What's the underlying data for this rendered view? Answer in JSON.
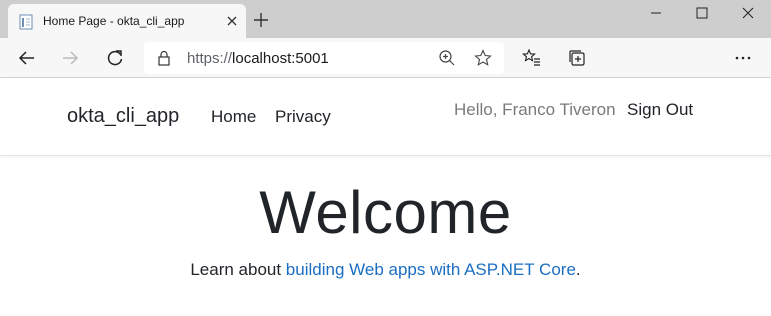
{
  "browser": {
    "tab_title": "Home Page - okta_cli_app",
    "url_prefix": "https://",
    "url_host": "localhost:5001",
    "icons": [
      "page-icon",
      "close-icon",
      "plus-icon",
      "minimize-icon",
      "maximize-icon",
      "close-window-icon",
      "back-arrow-icon",
      "forward-arrow-icon",
      "refresh-icon",
      "lock-icon",
      "zoom-icon",
      "star-icon",
      "favorites-icon",
      "collections-icon",
      "more-icon"
    ]
  },
  "navbar": {
    "brand": "okta_cli_app",
    "links": [
      "Home",
      "Privacy"
    ],
    "greeting": "Hello, Franco Tiveron",
    "sign_out": "Sign Out"
  },
  "main": {
    "heading": "Welcome",
    "learn_prefix": "Learn about ",
    "learn_link": "building Web apps with ASP.NET Core",
    "learn_suffix": "."
  },
  "colors": {
    "link": "#1b6ec2",
    "tabstrip": "#cecece",
    "toolbar": "#f7f7f7"
  }
}
